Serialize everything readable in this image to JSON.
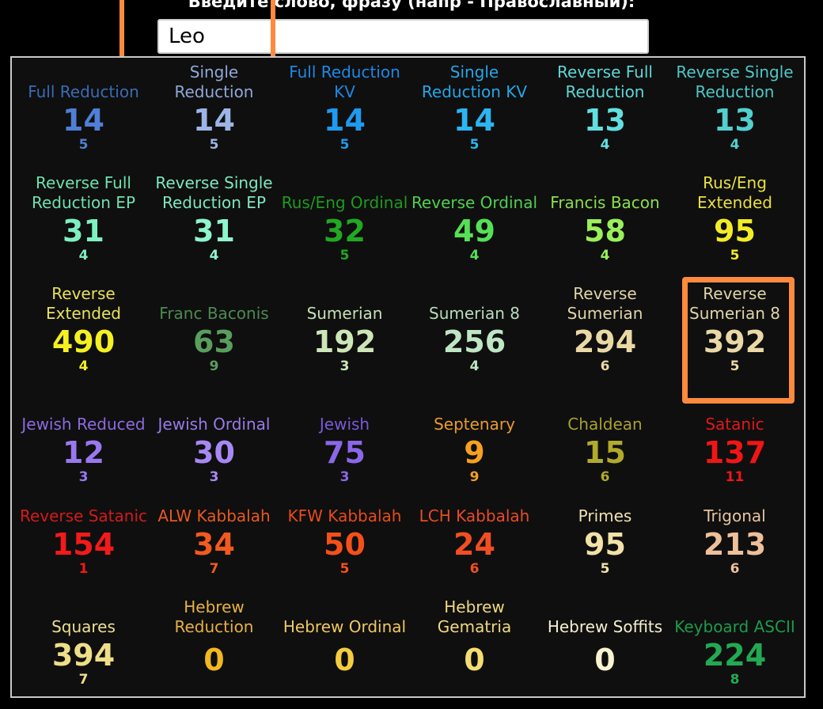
{
  "prompt_text": "Введите слово, фразу (напр - Православный):",
  "input": {
    "value": "Leo"
  },
  "cells": [
    {
      "label": "Full Reduction",
      "value": "14",
      "sub": "5",
      "label_color": "#3a6bb5",
      "value_color": "#4f7fd6"
    },
    {
      "label": "Single\nReduction",
      "value": "14",
      "sub": "5",
      "label_color": "#8fa8d8",
      "value_color": "#9db5e6"
    },
    {
      "label": "Full Reduction\nKV",
      "value": "14",
      "sub": "5",
      "label_color": "#1e88e5",
      "value_color": "#1e9af0"
    },
    {
      "label": "Single\nReduction KV",
      "value": "14",
      "sub": "5",
      "label_color": "#26a6e8",
      "value_color": "#2bb5f2"
    },
    {
      "label": "Reverse Full\nReduction",
      "value": "13",
      "sub": "4",
      "label_color": "#5ed6d6",
      "value_color": "#62e0e0"
    },
    {
      "label": "Reverse Single\nReduction",
      "value": "13",
      "sub": "4",
      "label_color": "#4fc6c6",
      "value_color": "#52d0d0"
    },
    {
      "label": "Reverse Full\nReduction EP",
      "value": "31",
      "sub": "4",
      "label_color": "#6ee0b0",
      "value_color": "#7ef0c0"
    },
    {
      "label": "Reverse Single\nReduction EP",
      "value": "31",
      "sub": "4",
      "label_color": "#7ee8c0",
      "value_color": "#8ef5cc"
    },
    {
      "label": "Rus/Eng Ordinal",
      "value": "32",
      "sub": "5",
      "label_color": "#1f9a1f",
      "value_color": "#22a822"
    },
    {
      "label": "Reverse Ordinal",
      "value": "49",
      "sub": "4",
      "label_color": "#4fd04f",
      "value_color": "#55e055"
    },
    {
      "label": "Francis Bacon",
      "value": "58",
      "sub": "4",
      "label_color": "#8ae04a",
      "value_color": "#9af05a"
    },
    {
      "label": "Rus/Eng\nExtended",
      "value": "95",
      "sub": "5",
      "label_color": "#e8e040",
      "value_color": "#f2ec28"
    },
    {
      "label": "Reverse\nExtended",
      "value": "490",
      "sub": "4",
      "label_color": "#e8e060",
      "value_color": "#f5f020"
    },
    {
      "label": "Franc Baconis",
      "value": "63",
      "sub": "9",
      "label_color": "#4c8a50",
      "value_color": "#5a9e5e"
    },
    {
      "label": "Sumerian",
      "value": "192",
      "sub": "3",
      "label_color": "#c8e0b4",
      "value_color": "#cde6b8"
    },
    {
      "label": "Sumerian 8",
      "value": "256",
      "sub": "4",
      "label_color": "#b6dcbc",
      "value_color": "#bfe6c4"
    },
    {
      "label": "Reverse\nSumerian",
      "value": "294",
      "sub": "6",
      "label_color": "#e0d4a8",
      "value_color": "#ead9a6"
    },
    {
      "label": "Reverse\nSumerian 8",
      "value": "392",
      "sub": "5",
      "label_color": "#e0d4a8",
      "value_color": "#ead9a6"
    },
    {
      "label": "Jewish Reduced",
      "value": "12",
      "sub": "3",
      "label_color": "#8c6ae0",
      "value_color": "#9a78f0"
    },
    {
      "label": "Jewish Ordinal",
      "value": "30",
      "sub": "3",
      "label_color": "#9a7ae8",
      "value_color": "#a888f5"
    },
    {
      "label": "Jewish",
      "value": "75",
      "sub": "3",
      "label_color": "#7a5ad8",
      "value_color": "#8a68e8"
    },
    {
      "label": "Septenary",
      "value": "9",
      "sub": "9",
      "label_color": "#e89a30",
      "value_color": "#f5a020"
    },
    {
      "label": "Chaldean",
      "value": "15",
      "sub": "6",
      "label_color": "#a8a030",
      "value_color": "#b2aa2a"
    },
    {
      "label": "Satanic",
      "value": "137",
      "sub": "11",
      "label_color": "#e01818",
      "value_color": "#f21515"
    },
    {
      "label": "Reverse Satanic",
      "value": "154",
      "sub": "1",
      "label_color": "#d41a1a",
      "value_color": "#f21a1a"
    },
    {
      "label": "ALW Kabbalah",
      "value": "34",
      "sub": "7",
      "label_color": "#e85820",
      "value_color": "#f25a1e"
    },
    {
      "label": "KFW Kabbalah",
      "value": "50",
      "sub": "5",
      "label_color": "#e84a1a",
      "value_color": "#f5501a"
    },
    {
      "label": "LCH Kabbalah",
      "value": "24",
      "sub": "6",
      "label_color": "#e84a28",
      "value_color": "#f24e22"
    },
    {
      "label": "Primes",
      "value": "95",
      "sub": "5",
      "label_color": "#f0e0b0",
      "value_color": "#f2e2a8"
    },
    {
      "label": "Trigonal",
      "value": "213",
      "sub": "6",
      "label_color": "#e8c4a0",
      "value_color": "#eec09a"
    },
    {
      "label": "Squares",
      "value": "394",
      "sub": "7",
      "label_color": "#ece090",
      "value_color": "#eede88"
    },
    {
      "label": "Hebrew\nReduction",
      "value": "0",
      "sub": "",
      "label_color": "#e8b040",
      "value_color": "#f2b820"
    },
    {
      "label": "Hebrew Ordinal",
      "value": "0",
      "sub": "",
      "label_color": "#f0c860",
      "value_color": "#f5cc40"
    },
    {
      "label": "Hebrew\nGematria",
      "value": "0",
      "sub": "",
      "label_color": "#f0d880",
      "value_color": "#f5de70"
    },
    {
      "label": "Hebrew Soffits",
      "value": "0",
      "sub": "",
      "label_color": "#f5f0d0",
      "value_color": "#f7f2d0"
    },
    {
      "label": "Keyboard ASCII",
      "value": "224",
      "sub": "8",
      "label_color": "#1e9a4a",
      "value_color": "#22aa52"
    }
  ]
}
